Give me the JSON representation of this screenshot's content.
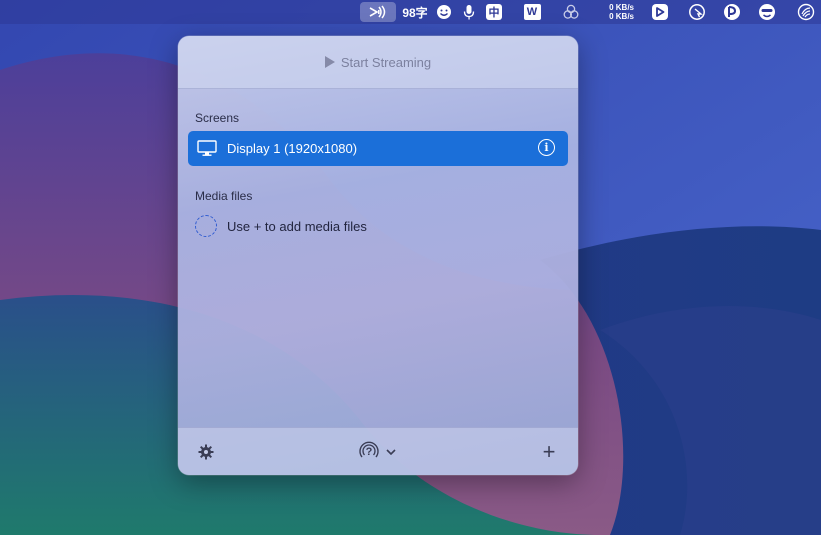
{
  "menubar": {
    "word_count": "98字",
    "ime_label": "中",
    "wps_label": "W",
    "network_up": "0 KB/s",
    "network_down": "0 KB/s",
    "icons": [
      "airplay-streaming-icon",
      "emoji-icon",
      "microphone-icon",
      "ime-icon",
      "wps-icon",
      "creative-cloud-icon",
      "network-monitor-icon",
      "screen-recorder-icon",
      "cursor-icon",
      "vpn-icon",
      "character-icon",
      "speed-icon"
    ]
  },
  "popover": {
    "start_label": "Start Streaming",
    "screens_title": "Screens",
    "display_label": "Display 1 (1920x1080)",
    "info_glyph": "i",
    "media_title": "Media files",
    "media_hint": "Use + to add media files",
    "footer": {
      "settings_icon": "gear-icon",
      "help_icon": "airplay-help-icon",
      "help_glyph": "?",
      "add_label": "+"
    }
  },
  "colors": {
    "accent": "#1b6fd9",
    "menubar": "#2e3896"
  }
}
